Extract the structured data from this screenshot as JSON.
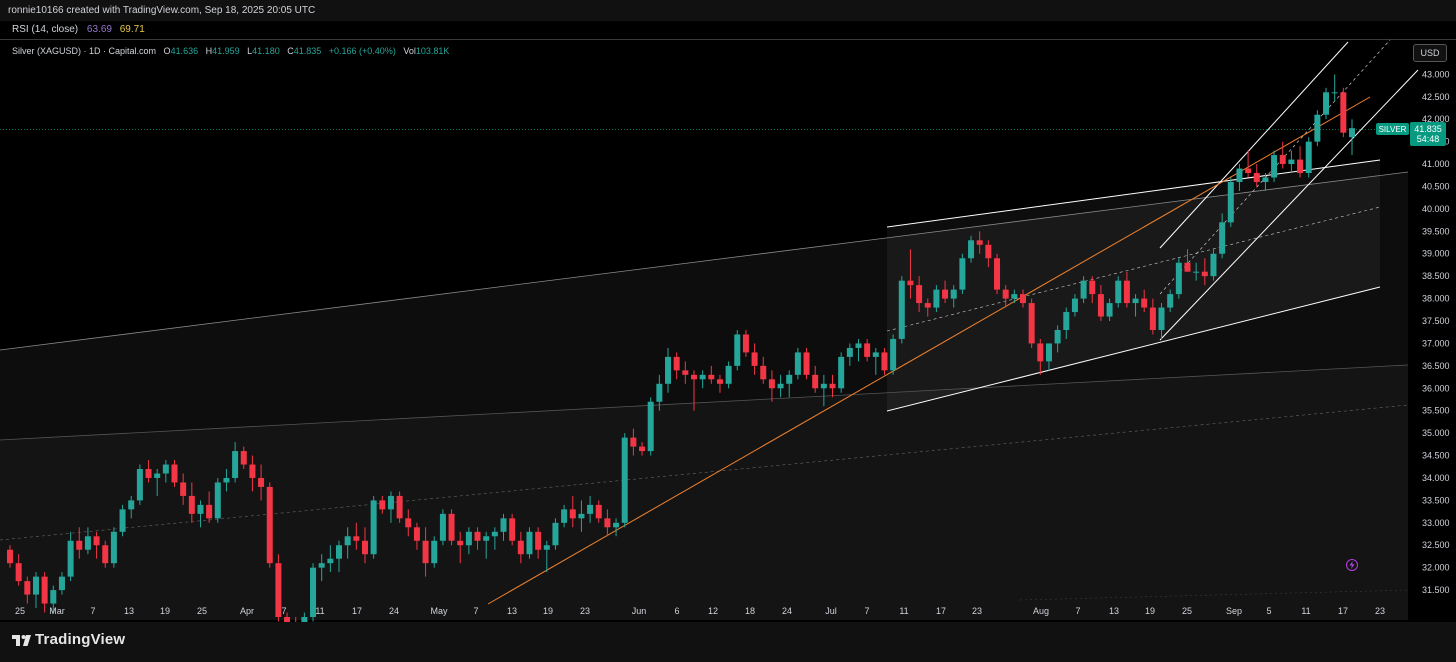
{
  "header": {
    "attribution": "ronnie10166 created with TradingView.com, Sep 18, 2025 20:05 UTC"
  },
  "rsi": {
    "label": "RSI (14, close)",
    "value1": "63.69",
    "value2": "69.71",
    "color1": "#9575cd",
    "color2": "#e6c84a"
  },
  "legend": {
    "symbol": "Silver (XAGUSD) · 1D · Capital.com",
    "open_key": "O",
    "open": "41.636",
    "high_key": "H",
    "high": "41.959",
    "low_key": "L",
    "low": "41.180",
    "close_key": "C",
    "close": "41.835",
    "change": "+0.166 (+0.40%)",
    "vol_key": "Vol",
    "vol": "103.81K"
  },
  "currency_button": "USD",
  "price_tag": {
    "symbol": "SILVER",
    "price": "41.835",
    "countdown": "54:48",
    "color": "#089981"
  },
  "footer": {
    "brand": "TradingView"
  },
  "colors": {
    "up": "#26a69a",
    "down": "#f23645",
    "background": "#000000"
  },
  "chart_data": {
    "type": "candlestick",
    "ylim": [
      30.9,
      43.9
    ],
    "y_ticks": [
      "43.000",
      "42.500",
      "42.000",
      "41.500",
      "41.000",
      "40.500",
      "40.000",
      "39.500",
      "39.000",
      "38.500",
      "38.000",
      "37.500",
      "37.000",
      "36.500",
      "36.000",
      "35.500",
      "35.000",
      "34.500",
      "34.000",
      "33.500",
      "33.000",
      "32.500",
      "32.000",
      "31.500"
    ],
    "x_ticks": [
      "25",
      "Mar",
      "7",
      "13",
      "19",
      "25",
      "Apr",
      "7",
      "11",
      "17",
      "24",
      "May",
      "7",
      "13",
      "19",
      "23",
      "Jun",
      "6",
      "12",
      "18",
      "24",
      "Jul",
      "7",
      "11",
      "17",
      "23",
      "Aug",
      "7",
      "13",
      "19",
      "25",
      "Sep",
      "5",
      "11",
      "17",
      "23"
    ],
    "candles": [
      [
        32.4,
        32.5,
        32.0,
        32.1
      ],
      [
        32.1,
        32.3,
        31.6,
        31.7
      ],
      [
        31.7,
        31.8,
        31.2,
        31.4
      ],
      [
        31.4,
        31.9,
        31.1,
        31.8
      ],
      [
        31.8,
        31.9,
        31.0,
        31.2
      ],
      [
        31.2,
        31.6,
        31.0,
        31.5
      ],
      [
        31.5,
        31.9,
        31.4,
        31.8
      ],
      [
        31.8,
        32.8,
        31.7,
        32.6
      ],
      [
        32.6,
        32.9,
        32.2,
        32.4
      ],
      [
        32.4,
        32.9,
        32.3,
        32.7
      ],
      [
        32.7,
        32.8,
        32.2,
        32.5
      ],
      [
        32.5,
        32.6,
        32.0,
        32.1
      ],
      [
        32.1,
        32.9,
        32.0,
        32.8
      ],
      [
        32.8,
        33.4,
        32.7,
        33.3
      ],
      [
        33.3,
        33.6,
        33.1,
        33.5
      ],
      [
        33.5,
        34.3,
        33.4,
        34.2
      ],
      [
        34.2,
        34.4,
        33.9,
        34.0
      ],
      [
        34.0,
        34.2,
        33.6,
        34.1
      ],
      [
        34.1,
        34.4,
        33.9,
        34.3
      ],
      [
        34.3,
        34.4,
        33.8,
        33.9
      ],
      [
        33.9,
        34.1,
        33.4,
        33.6
      ],
      [
        33.6,
        33.9,
        33.0,
        33.2
      ],
      [
        33.2,
        33.5,
        32.9,
        33.4
      ],
      [
        33.4,
        33.7,
        33.0,
        33.1
      ],
      [
        33.1,
        34.0,
        33.0,
        33.9
      ],
      [
        33.9,
        34.2,
        33.7,
        34.0
      ],
      [
        34.0,
        34.8,
        33.9,
        34.6
      ],
      [
        34.6,
        34.7,
        34.2,
        34.3
      ],
      [
        34.3,
        34.5,
        33.7,
        34.0
      ],
      [
        34.0,
        34.3,
        33.5,
        33.8
      ],
      [
        33.8,
        33.9,
        32.0,
        32.1
      ],
      [
        32.1,
        32.3,
        30.8,
        30.9
      ],
      [
        30.9,
        31.0,
        30.5,
        30.6
      ],
      [
        30.6,
        30.9,
        30.2,
        30.5
      ],
      [
        30.5,
        31.0,
        30.4,
        30.9
      ],
      [
        30.9,
        32.1,
        30.8,
        32.0
      ],
      [
        32.0,
        32.3,
        31.7,
        32.1
      ],
      [
        32.1,
        32.5,
        31.9,
        32.2
      ],
      [
        32.2,
        32.6,
        31.9,
        32.5
      ],
      [
        32.5,
        32.9,
        32.2,
        32.7
      ],
      [
        32.7,
        33.0,
        32.4,
        32.6
      ],
      [
        32.6,
        32.9,
        32.1,
        32.3
      ],
      [
        32.3,
        33.6,
        32.2,
        33.5
      ],
      [
        33.5,
        33.6,
        33.2,
        33.3
      ],
      [
        33.3,
        33.7,
        33.0,
        33.6
      ],
      [
        33.6,
        33.7,
        33.0,
        33.1
      ],
      [
        33.1,
        33.3,
        32.7,
        32.9
      ],
      [
        32.9,
        33.0,
        32.4,
        32.6
      ],
      [
        32.6,
        32.9,
        31.8,
        32.1
      ],
      [
        32.1,
        32.7,
        32.0,
        32.6
      ],
      [
        32.6,
        33.3,
        32.5,
        33.2
      ],
      [
        33.2,
        33.3,
        32.5,
        32.6
      ],
      [
        32.6,
        32.8,
        32.1,
        32.5
      ],
      [
        32.5,
        32.9,
        32.3,
        32.8
      ],
      [
        32.8,
        32.9,
        32.4,
        32.6
      ],
      [
        32.6,
        32.8,
        32.2,
        32.7
      ],
      [
        32.7,
        32.9,
        32.4,
        32.8
      ],
      [
        32.8,
        33.2,
        32.6,
        33.1
      ],
      [
        33.1,
        33.2,
        32.5,
        32.6
      ],
      [
        32.6,
        32.8,
        32.1,
        32.3
      ],
      [
        32.3,
        32.9,
        32.2,
        32.8
      ],
      [
        32.8,
        32.9,
        32.2,
        32.4
      ],
      [
        32.4,
        32.6,
        31.9,
        32.5
      ],
      [
        32.5,
        33.1,
        32.4,
        33.0
      ],
      [
        33.0,
        33.4,
        32.9,
        33.3
      ],
      [
        33.3,
        33.6,
        32.9,
        33.1
      ],
      [
        33.1,
        33.5,
        32.8,
        33.2
      ],
      [
        33.2,
        33.6,
        33.0,
        33.4
      ],
      [
        33.4,
        33.5,
        33.0,
        33.1
      ],
      [
        33.1,
        33.3,
        32.7,
        32.9
      ],
      [
        32.9,
        33.1,
        32.7,
        33.0
      ],
      [
        33.0,
        35.0,
        32.9,
        34.9
      ],
      [
        34.9,
        35.1,
        34.5,
        34.7
      ],
      [
        34.7,
        34.8,
        34.5,
        34.6
      ],
      [
        34.6,
        35.8,
        34.5,
        35.7
      ],
      [
        35.7,
        36.3,
        35.5,
        36.1
      ],
      [
        36.1,
        36.9,
        35.9,
        36.7
      ],
      [
        36.7,
        36.8,
        36.2,
        36.4
      ],
      [
        36.4,
        36.6,
        36.1,
        36.3
      ],
      [
        36.3,
        36.4,
        35.5,
        36.2
      ],
      [
        36.2,
        36.4,
        36.0,
        36.3
      ],
      [
        36.3,
        36.5,
        36.1,
        36.2
      ],
      [
        36.2,
        36.3,
        35.9,
        36.1
      ],
      [
        36.1,
        36.6,
        36.0,
        36.5
      ],
      [
        36.5,
        37.3,
        36.4,
        37.2
      ],
      [
        37.2,
        37.3,
        36.7,
        36.8
      ],
      [
        36.8,
        37.0,
        36.3,
        36.5
      ],
      [
        36.5,
        36.7,
        36.1,
        36.2
      ],
      [
        36.2,
        36.4,
        35.7,
        36.0
      ],
      [
        36.0,
        36.3,
        35.8,
        36.1
      ],
      [
        36.1,
        36.4,
        35.8,
        36.3
      ],
      [
        36.3,
        36.9,
        36.2,
        36.8
      ],
      [
        36.8,
        36.9,
        36.2,
        36.3
      ],
      [
        36.3,
        36.5,
        35.9,
        36.0
      ],
      [
        36.0,
        36.3,
        35.6,
        36.1
      ],
      [
        36.1,
        36.3,
        35.8,
        36.0
      ],
      [
        36.0,
        36.8,
        35.9,
        36.7
      ],
      [
        36.7,
        37.0,
        36.5,
        36.9
      ],
      [
        36.9,
        37.1,
        36.6,
        37.0
      ],
      [
        37.0,
        37.1,
        36.6,
        36.7
      ],
      [
        36.7,
        36.9,
        36.3,
        36.8
      ],
      [
        36.8,
        36.9,
        36.3,
        36.4
      ],
      [
        36.4,
        37.2,
        36.3,
        37.1
      ],
      [
        37.1,
        38.5,
        37.0,
        38.4
      ],
      [
        38.4,
        39.1,
        38.0,
        38.3
      ],
      [
        38.3,
        38.5,
        37.7,
        37.9
      ],
      [
        37.9,
        38.0,
        37.6,
        37.8
      ],
      [
        37.8,
        38.3,
        37.7,
        38.2
      ],
      [
        38.2,
        38.4,
        37.9,
        38.0
      ],
      [
        38.0,
        38.3,
        37.8,
        38.2
      ],
      [
        38.2,
        39.0,
        38.1,
        38.9
      ],
      [
        38.9,
        39.4,
        38.8,
        39.3
      ],
      [
        39.3,
        39.5,
        39.0,
        39.2
      ],
      [
        39.2,
        39.3,
        38.7,
        38.9
      ],
      [
        38.9,
        39.0,
        38.1,
        38.2
      ],
      [
        38.2,
        38.3,
        37.8,
        38.0
      ],
      [
        38.0,
        38.2,
        37.9,
        38.1
      ],
      [
        38.1,
        38.2,
        37.8,
        37.9
      ],
      [
        37.9,
        38.0,
        36.9,
        37.0
      ],
      [
        37.0,
        37.1,
        36.3,
        36.6
      ],
      [
        36.6,
        37.0,
        36.4,
        37.0
      ],
      [
        37.0,
        37.4,
        36.8,
        37.3
      ],
      [
        37.3,
        37.8,
        37.1,
        37.7
      ],
      [
        37.7,
        38.1,
        37.6,
        38.0
      ],
      [
        38.0,
        38.5,
        37.9,
        38.4
      ],
      [
        38.4,
        38.5,
        37.9,
        38.1
      ],
      [
        38.1,
        38.3,
        37.5,
        37.6
      ],
      [
        37.6,
        38.0,
        37.5,
        37.9
      ],
      [
        37.9,
        38.5,
        37.8,
        38.4
      ],
      [
        38.4,
        38.6,
        37.8,
        37.9
      ],
      [
        37.9,
        38.1,
        37.6,
        38.0
      ],
      [
        38.0,
        38.2,
        37.7,
        37.8
      ],
      [
        37.8,
        38.0,
        37.2,
        37.3
      ],
      [
        37.3,
        37.9,
        37.1,
        37.8
      ],
      [
        37.8,
        38.2,
        37.7,
        38.1
      ],
      [
        38.1,
        38.9,
        38.0,
        38.8
      ],
      [
        38.8,
        39.1,
        38.6,
        38.6
      ],
      [
        38.6,
        38.8,
        38.4,
        38.6
      ],
      [
        38.6,
        38.9,
        38.3,
        38.5
      ],
      [
        38.5,
        39.1,
        38.4,
        39.0
      ],
      [
        39.0,
        39.9,
        38.9,
        39.7
      ],
      [
        39.7,
        40.7,
        39.6,
        40.6
      ],
      [
        40.6,
        41.0,
        40.4,
        40.9
      ],
      [
        40.9,
        41.3,
        40.7,
        40.8
      ],
      [
        40.8,
        41.0,
        40.5,
        40.6
      ],
      [
        40.6,
        40.8,
        40.4,
        40.7
      ],
      [
        40.7,
        41.3,
        40.6,
        41.2
      ],
      [
        41.2,
        41.5,
        40.9,
        41.0
      ],
      [
        41.0,
        41.3,
        40.8,
        41.1
      ],
      [
        41.1,
        41.4,
        40.7,
        40.8
      ],
      [
        40.8,
        41.6,
        40.7,
        41.5
      ],
      [
        41.5,
        42.2,
        41.4,
        42.1
      ],
      [
        42.1,
        42.7,
        42.0,
        42.6
      ],
      [
        42.6,
        43.0,
        42.4,
        42.6
      ],
      [
        42.6,
        42.7,
        41.6,
        41.7
      ],
      [
        41.6,
        42.0,
        41.2,
        41.8
      ]
    ]
  }
}
